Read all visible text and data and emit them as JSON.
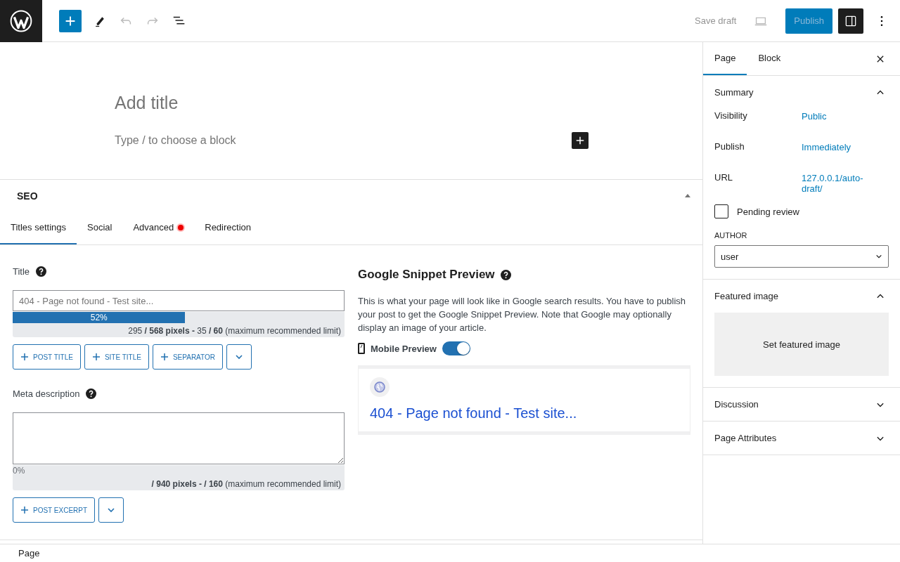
{
  "toolbar": {
    "save_draft": "Save draft",
    "publish": "Publish"
  },
  "editor": {
    "title_placeholder": "Add title",
    "block_placeholder": "Type / to choose a block"
  },
  "seo": {
    "heading": "SEO",
    "expanded": true,
    "tabs": [
      {
        "label": "Titles settings",
        "selected": true,
        "alert": false
      },
      {
        "label": "Social",
        "selected": false,
        "alert": false
      },
      {
        "label": "Advanced",
        "selected": false,
        "alert": true
      },
      {
        "label": "Redirection",
        "selected": false,
        "alert": false
      }
    ],
    "title": {
      "label": "Title",
      "placeholder": "404 - Page not found - Test site...",
      "level": 0.52,
      "percent": "52%",
      "counter": "295 **/ 568 pixels -** 35 **/ 60** (maximum recommended limit)",
      "buttons": [
        "POST TITLE",
        "SITE TITLE",
        "SEPARATOR"
      ]
    },
    "meta": {
      "label": "Meta description",
      "percent": "0%",
      "counter": "**/ 940 pixels -**  **/ 160** (maximum recommended limit)",
      "buttons": [
        "POST EXCERPT"
      ]
    },
    "snippet": {
      "heading": "Google Snippet Preview",
      "description": "This is what your page will look like in Google search results. You have to publish your post to get the Google Snippet Preview. Note that Google may optionally display an image of your article.",
      "mobile_preview": {
        "label": "Mobile Preview",
        "on": true
      },
      "result_title": "404 - Page not found - Test site..."
    }
  },
  "sidebar": {
    "tabs": [
      {
        "label": "Page",
        "selected": true
      },
      {
        "label": "Block",
        "selected": false
      }
    ],
    "panels": [
      {
        "kind": "summary",
        "title": "Summary",
        "expanded": true,
        "rows": [
          {
            "label": "Visibility",
            "value": "Public"
          },
          {
            "label": "Publish",
            "value": "Immediately"
          },
          {
            "label": "URL",
            "value": "127.0.0.1/auto-draft/"
          }
        ],
        "pending_review": {
          "label": "Pending review",
          "checked": false
        },
        "author": {
          "label": "AUTHOR",
          "value": "user"
        }
      },
      {
        "kind": "featured",
        "title": "Featured image",
        "expanded": true,
        "button": "Set featured image"
      },
      {
        "title": "Discussion",
        "expanded": false
      },
      {
        "title": "Page Attributes",
        "expanded": false
      }
    ]
  },
  "footer": {
    "breadcrumb": "Page"
  }
}
